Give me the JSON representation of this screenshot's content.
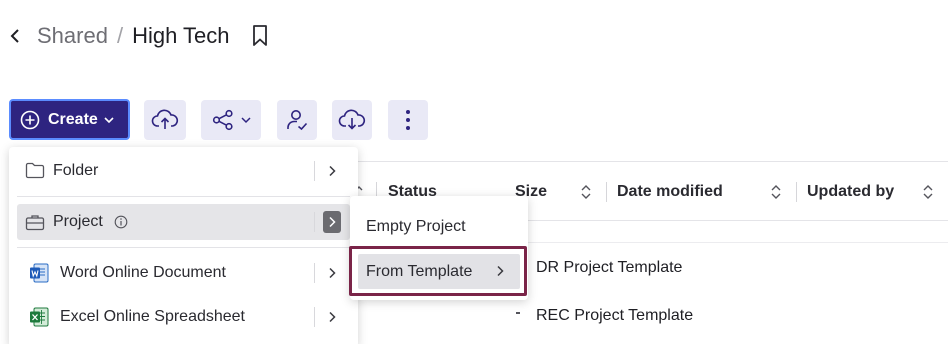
{
  "breadcrumb": {
    "parent": "Shared",
    "separator": "/",
    "title": "High Tech"
  },
  "toolbar": {
    "create_label": "Create"
  },
  "table": {
    "columns": [
      {
        "label": "Status"
      },
      {
        "label": "Size"
      },
      {
        "label": "Date modified"
      },
      {
        "label": "Updated by"
      }
    ]
  },
  "create_menu": {
    "items": [
      {
        "label": "Folder",
        "icon": "folder-icon"
      },
      {
        "label": "Project",
        "icon": "briefcase-icon",
        "info_icon": "info-icon"
      },
      {
        "label": "Word Online Document",
        "icon": "word-icon"
      },
      {
        "label": "Excel Online Spreadsheet",
        "icon": "excel-icon"
      }
    ]
  },
  "project_submenu": {
    "items": [
      {
        "label": "Empty Project"
      },
      {
        "label": "From Template"
      }
    ]
  },
  "template_submenu": {
    "items": [
      {
        "label": "DR Project Template"
      },
      {
        "label": "REC Project Template"
      }
    ]
  },
  "colors": {
    "create_bg": "#2e2480",
    "create_border": "#5b8cff",
    "tool_bg": "#e9e9f6",
    "tool_icon": "#2e2480",
    "highlight": "#7a2448"
  }
}
